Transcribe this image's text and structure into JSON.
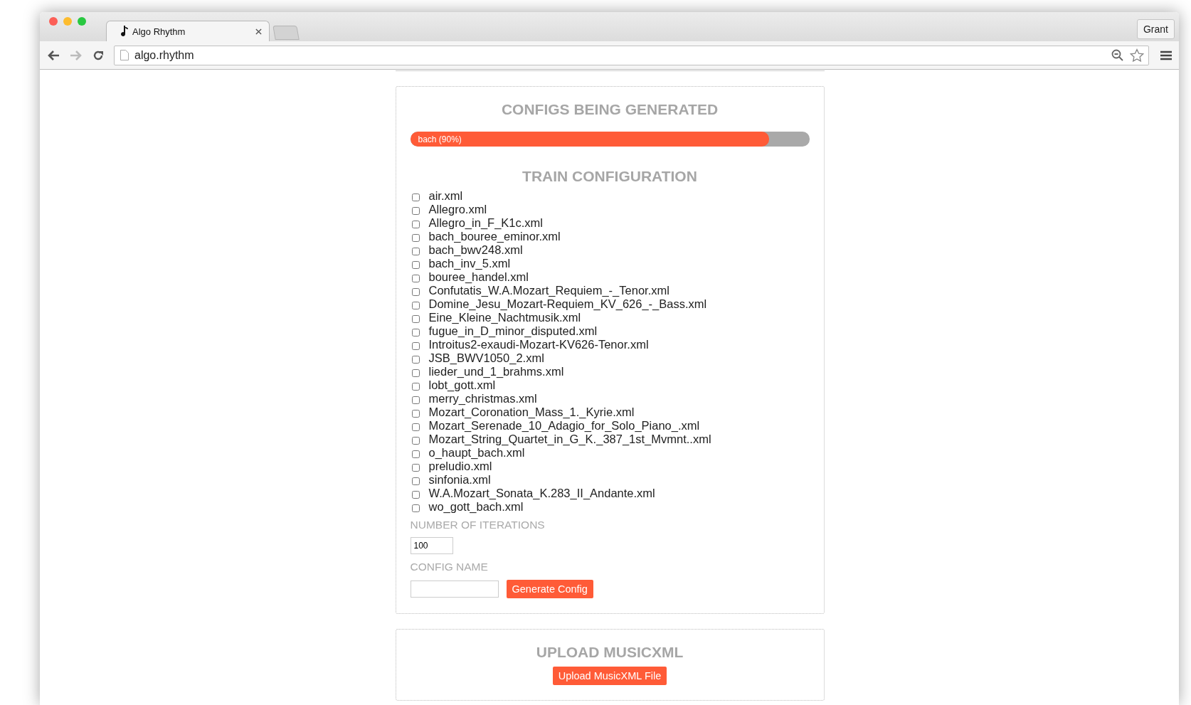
{
  "browser": {
    "tab": {
      "title": "Algo Rhythm",
      "selected": true
    },
    "profile": "Grant",
    "url": "algo.rhythm"
  },
  "generating": {
    "title": "CONFIGS BEING GENERATED",
    "progress": [
      {
        "label": "bach (90%)",
        "level": 0.9
      }
    ]
  },
  "train": {
    "title": "TRAIN CONFIGURATION",
    "files": [
      {
        "name": "air.xml",
        "checked": false
      },
      {
        "name": "Allegro.xml",
        "checked": false
      },
      {
        "name": "Allegro_in_F_K1c.xml",
        "checked": false
      },
      {
        "name": "bach_bouree_eminor.xml",
        "checked": false
      },
      {
        "name": "bach_bwv248.xml",
        "checked": false
      },
      {
        "name": "bach_inv_5.xml",
        "checked": false
      },
      {
        "name": "bouree_handel.xml",
        "checked": false
      },
      {
        "name": "Confutatis_W.A.Mozart_Requiem_-_Tenor.xml",
        "checked": false
      },
      {
        "name": "Domine_Jesu_Mozart-Requiem_KV_626_-_Bass.xml",
        "checked": false
      },
      {
        "name": "Eine_Kleine_Nachtmusik.xml",
        "checked": false
      },
      {
        "name": "fugue_in_D_minor_disputed.xml",
        "checked": false
      },
      {
        "name": "Introitus2-exaudi-Mozart-KV626-Tenor.xml",
        "checked": false
      },
      {
        "name": "JSB_BWV1050_2.xml",
        "checked": false
      },
      {
        "name": "lieder_und_1_brahms.xml",
        "checked": false
      },
      {
        "name": "lobt_gott.xml",
        "checked": false
      },
      {
        "name": "merry_christmas.xml",
        "checked": false
      },
      {
        "name": "Mozart_Coronation_Mass_1._Kyrie.xml",
        "checked": false
      },
      {
        "name": "Mozart_Serenade_10_Adagio_for_Solo_Piano_.xml",
        "checked": false
      },
      {
        "name": "Mozart_String_Quartet_in_G_K._387_1st_Mvmnt..xml",
        "checked": false
      },
      {
        "name": "o_haupt_bach.xml",
        "checked": false
      },
      {
        "name": "preludio.xml",
        "checked": false
      },
      {
        "name": "sinfonia.xml",
        "checked": false
      },
      {
        "name": "W.A.Mozart_Sonata_K.283_II_Andante.xml",
        "checked": false
      },
      {
        "name": "wo_gott_bach.xml",
        "checked": false
      }
    ],
    "iterations": {
      "label": "NUMBER OF ITERATIONS",
      "value": "100"
    },
    "config_name": {
      "label": "CONFIG NAME"
    },
    "button": "Generate Config"
  },
  "upload": {
    "title": "UPLOAD MUSICXML",
    "button": "Upload MusicXML File"
  }
}
